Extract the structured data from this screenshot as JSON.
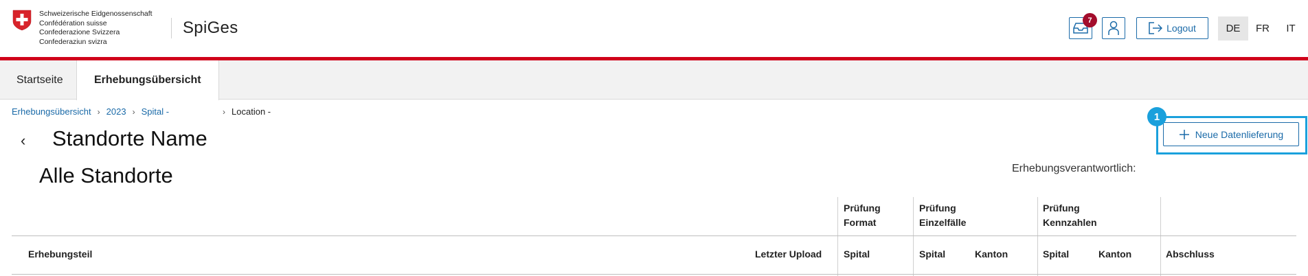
{
  "header": {
    "confederation_lines": [
      "Schweizerische Eidgenossenschaft",
      "Confédération suisse",
      "Confederazione Svizzera",
      "Confederaziun svizra"
    ],
    "app_title": "SpiGes",
    "notification_count": "7",
    "logout_label": "Logout",
    "languages": [
      "DE",
      "FR",
      "IT"
    ],
    "active_language": "DE"
  },
  "nav": {
    "tabs": [
      {
        "label": "Startseite",
        "active": false
      },
      {
        "label": "Erhebungsübersicht",
        "active": true
      }
    ]
  },
  "breadcrumb": {
    "items": [
      "Erhebungsübersicht",
      "2023",
      "Spital -"
    ],
    "current": "Location -"
  },
  "page": {
    "title": "Standorte Name",
    "section_title": "Alle Standorte",
    "responsible_label": "Erhebungsverantwortlich:",
    "new_delivery_label": "Neue Datenlieferung",
    "step_number": "1"
  },
  "table": {
    "groups": [
      {
        "line1": "Prüfung",
        "line2": "Format"
      },
      {
        "line1": "Prüfung",
        "line2": "Einzelfälle"
      },
      {
        "line1": "Prüfung",
        "line2": "Kennzahlen"
      }
    ],
    "columns": {
      "erhebungsteil": "Erhebungsteil",
      "letzter_upload": "Letzter Upload",
      "format_spital": "Spital",
      "einzel_spital": "Spital",
      "einzel_kanton": "Kanton",
      "kennz_spital": "Spital",
      "kennz_kanton": "Kanton",
      "abschluss": "Abschluss"
    }
  },
  "colors": {
    "accent_blue": "#1a6aa8",
    "brand_red": "#d0021b",
    "badge_red": "#a30d2c",
    "highlight_blue": "#1aa0dc"
  }
}
